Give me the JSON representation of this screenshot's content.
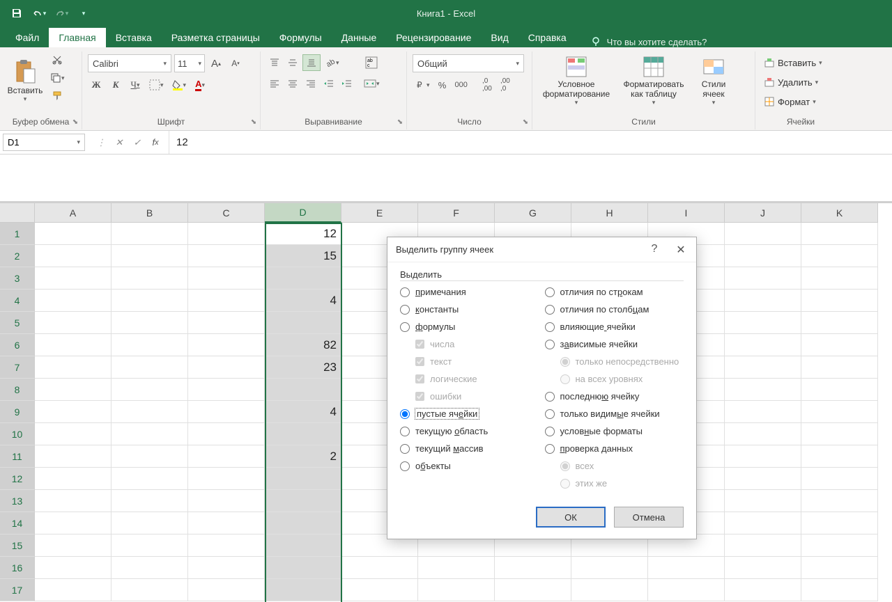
{
  "title": "Книга1  -  Excel",
  "tabs": [
    "Файл",
    "Главная",
    "Вставка",
    "Разметка страницы",
    "Формулы",
    "Данные",
    "Рецензирование",
    "Вид",
    "Справка"
  ],
  "activeTab": 1,
  "tellMe": "Что вы хотите сделать?",
  "ribbon": {
    "clipboard": {
      "label": "Буфер обмена",
      "paste": "Вставить"
    },
    "font": {
      "label": "Шрифт",
      "name": "Calibri",
      "size": "11"
    },
    "alignment": {
      "label": "Выравнивание"
    },
    "number": {
      "label": "Число",
      "format": "Общий"
    },
    "styles": {
      "label": "Стили",
      "cond": "Условное\nформатирование",
      "table": "Форматировать\nкак таблицу",
      "cellStyles": "Стили\nячеек"
    },
    "cells": {
      "label": "Ячейки",
      "insert": "Вставить",
      "delete": "Удалить",
      "format": "Формат"
    }
  },
  "nameBox": "D1",
  "formula": "12",
  "columns": [
    "A",
    "B",
    "C",
    "D",
    "E",
    "F",
    "G",
    "H",
    "I",
    "J",
    "K"
  ],
  "rows": 17,
  "selectedCol": 3,
  "cellData": {
    "1": "12",
    "2": "15",
    "4": "4",
    "6": "82",
    "7": "23",
    "9": "4",
    "11": "2"
  },
  "dialog": {
    "title": "Выделить группу ячеек",
    "groupLabel": "Выделить",
    "left": [
      {
        "key": "notes",
        "label": "примечания",
        "u": 0
      },
      {
        "key": "constants",
        "label": "константы",
        "u": 0
      },
      {
        "key": "formulas",
        "label": "формулы",
        "u": 0
      },
      {
        "key": "blanks",
        "label": "пустые ячейки",
        "u": 9,
        "selected": true
      },
      {
        "key": "region",
        "label": "текущую область",
        "u": 8
      },
      {
        "key": "array",
        "label": "текущий массив",
        "u": 8
      },
      {
        "key": "objects",
        "label": "объекты",
        "u": 1
      }
    ],
    "formulaChecks": [
      "числа",
      "текст",
      "логические",
      "ошибки"
    ],
    "right": [
      {
        "key": "rowdiff",
        "label": "отличия по строкам",
        "u": 13
      },
      {
        "key": "coldiff",
        "label": "отличия по столбцам",
        "u": 16
      },
      {
        "key": "precedents",
        "label": "влияющие ячейки",
        "u": 8
      },
      {
        "key": "dependents",
        "label": "зависимые ячейки",
        "u": 1
      },
      {
        "key": "last",
        "label": "последнюю ячейку",
        "u": 8
      },
      {
        "key": "visible",
        "label": "только видимые ячейки",
        "u": 12
      },
      {
        "key": "condfmt",
        "label": "условные форматы",
        "u": 5
      },
      {
        "key": "datavalid",
        "label": "проверка данных",
        "u": 0
      }
    ],
    "depOptions": [
      "только непосредственно",
      "на всех уровнях"
    ],
    "valOptions": [
      "всех",
      "этих же"
    ],
    "ok": "ОК",
    "cancel": "Отмена"
  }
}
